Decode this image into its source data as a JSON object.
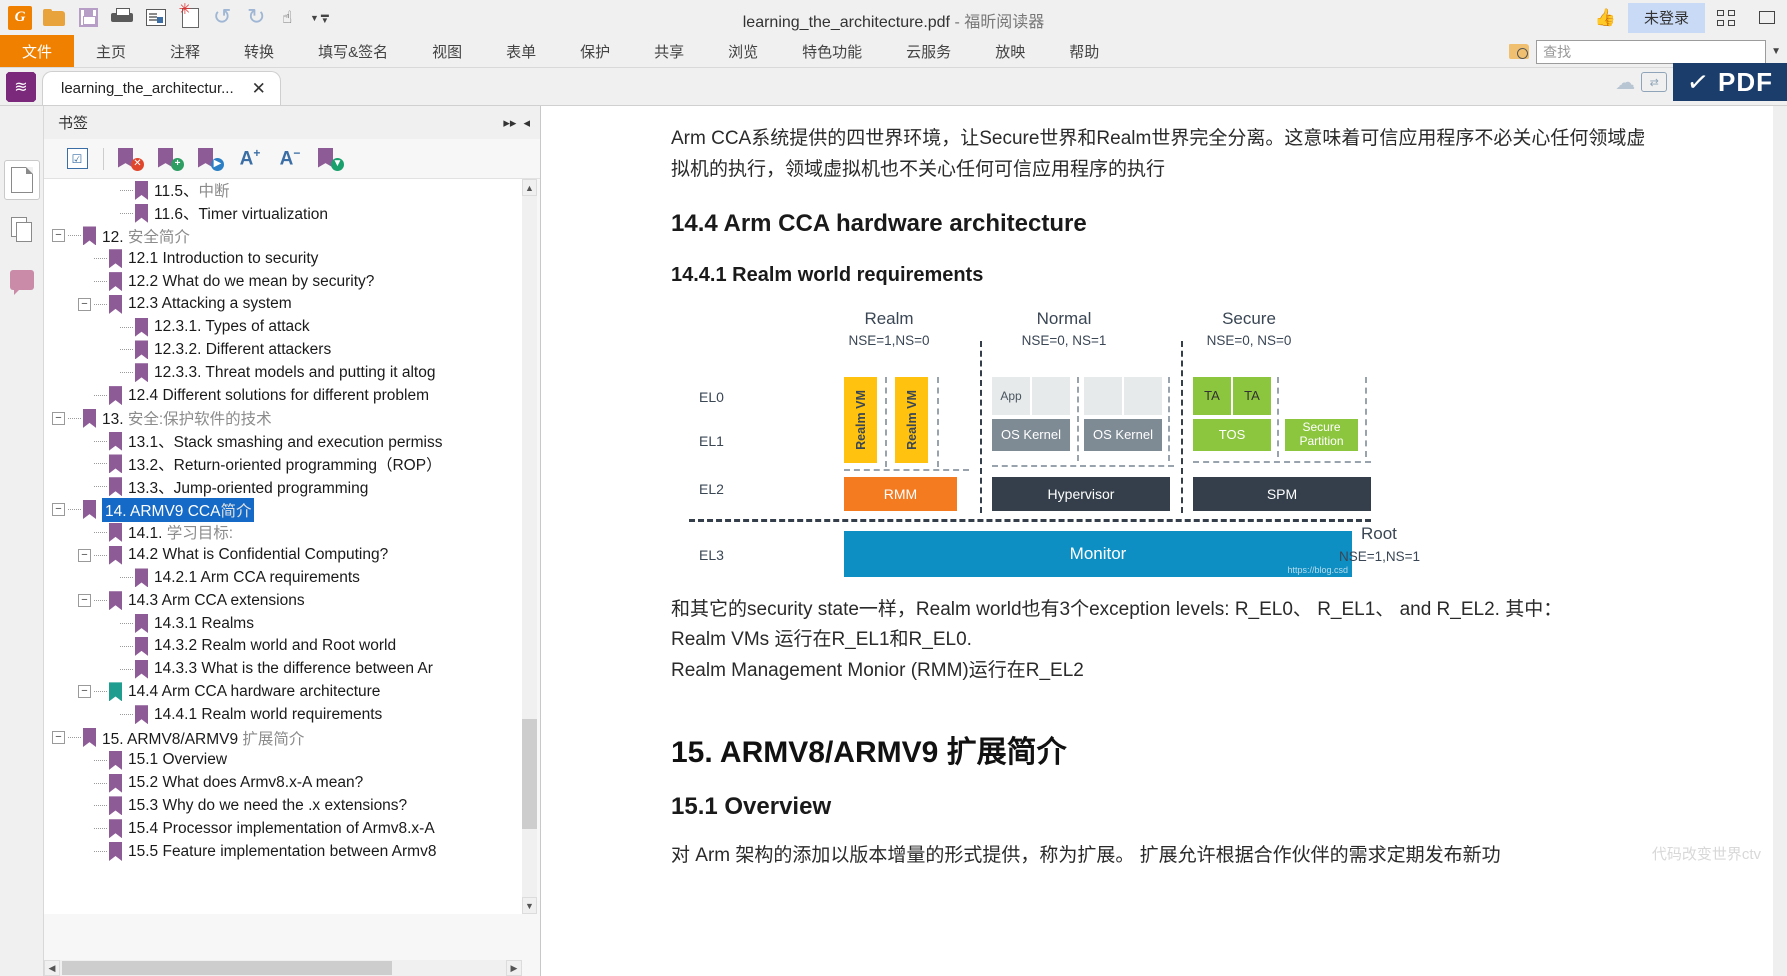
{
  "window": {
    "title_file": "learning_the_architecture.pdf",
    "title_sep": " - ",
    "title_app": "福昕阅读器",
    "login_status": "未登录"
  },
  "quick_access": [
    {
      "name": "app-logo-icon",
      "label": "G"
    },
    {
      "name": "open-folder-icon",
      "label": ""
    },
    {
      "name": "save-icon",
      "label": ""
    },
    {
      "name": "print-icon",
      "label": ""
    },
    {
      "name": "properties-icon",
      "label": ""
    },
    {
      "name": "new-document-icon",
      "label": ""
    },
    {
      "name": "undo-icon",
      "label": "↶"
    },
    {
      "name": "redo-icon",
      "label": "↷"
    },
    {
      "name": "hand-tool-icon",
      "label": "☝"
    }
  ],
  "menu": {
    "items": [
      {
        "label": "文件",
        "active": true
      },
      {
        "label": "主页",
        "active": false
      },
      {
        "label": "注释",
        "active": false
      },
      {
        "label": "转换",
        "active": false
      },
      {
        "label": "填写&签名",
        "active": false
      },
      {
        "label": "视图",
        "active": false
      },
      {
        "label": "表单",
        "active": false
      },
      {
        "label": "保护",
        "active": false
      },
      {
        "label": "共享",
        "active": false
      },
      {
        "label": "浏览",
        "active": false
      },
      {
        "label": "特色功能",
        "active": false
      },
      {
        "label": "云服务",
        "active": false
      },
      {
        "label": "放映",
        "active": false
      },
      {
        "label": "帮助",
        "active": false
      }
    ]
  },
  "find": {
    "placeholder": "查找",
    "value": ""
  },
  "tab": {
    "label": "learning_the_architectur...",
    "close": "✕"
  },
  "pdf_banner": {
    "label": "PDF"
  },
  "bookmark_panel": {
    "title": "书签",
    "collapse_icon": "▸▸",
    "pin_icon": "◂",
    "toolbar": [
      {
        "name": "checklist-icon",
        "label": "☑"
      },
      {
        "name": "delete-bookmark-icon",
        "label": "✕"
      },
      {
        "name": "add-bookmark-icon",
        "label": "+"
      },
      {
        "name": "goto-bookmark-icon",
        "label": "▶"
      },
      {
        "name": "increase-font-icon",
        "label": "A",
        "sup": "+"
      },
      {
        "name": "decrease-font-icon",
        "label": "A",
        "sup": "−"
      },
      {
        "name": "expand-bookmark-icon",
        "label": "▾"
      }
    ],
    "items": [
      {
        "depth": 2,
        "toggle": null,
        "label": "11.5、",
        "cn": "中断",
        "mark": "purple",
        "selected": false
      },
      {
        "depth": 2,
        "toggle": null,
        "label": "11.6、Timer virtualization",
        "cn": "",
        "mark": "purple",
        "selected": false
      },
      {
        "depth": 0,
        "toggle": "−",
        "label": "12. ",
        "cn": "安全简介",
        "mark": "purple",
        "selected": false
      },
      {
        "depth": 1,
        "toggle": null,
        "label": "12.1 Introduction to security",
        "cn": "",
        "mark": "purple",
        "selected": false
      },
      {
        "depth": 1,
        "toggle": null,
        "label": "12.2 What do we mean by security?",
        "cn": "",
        "mark": "purple",
        "selected": false
      },
      {
        "depth": 1,
        "toggle": "−",
        "label": "12.3 Attacking a system",
        "cn": "",
        "mark": "purple",
        "selected": false
      },
      {
        "depth": 2,
        "toggle": null,
        "label": "12.3.1. Types of attack",
        "cn": "",
        "mark": "purple",
        "selected": false
      },
      {
        "depth": 2,
        "toggle": null,
        "label": "12.3.2. Different attackers",
        "cn": "",
        "mark": "purple",
        "selected": false
      },
      {
        "depth": 2,
        "toggle": null,
        "label": "12.3.3. Threat models and putting it altog",
        "cn": "",
        "mark": "purple",
        "selected": false
      },
      {
        "depth": 1,
        "toggle": null,
        "label": "12.4 Different solutions for different problem",
        "cn": "",
        "mark": "purple",
        "selected": false
      },
      {
        "depth": 0,
        "toggle": "−",
        "label": "13. ",
        "cn": "安全:保护软件的技术",
        "mark": "purple",
        "selected": false
      },
      {
        "depth": 1,
        "toggle": null,
        "label": "13.1、Stack smashing and execution permiss",
        "cn": "",
        "mark": "purple",
        "selected": false
      },
      {
        "depth": 1,
        "toggle": null,
        "label": "13.2、Return-oriented programming（ROP）",
        "cn": "",
        "mark": "purple",
        "selected": false
      },
      {
        "depth": 1,
        "toggle": null,
        "label": "13.3、Jump-oriented programming",
        "cn": "",
        "mark": "purple",
        "selected": false
      },
      {
        "depth": 0,
        "toggle": "−",
        "label": "14. ARMV9 CCA",
        "cn": "简介",
        "mark": "purple",
        "selected": true
      },
      {
        "depth": 1,
        "toggle": null,
        "label": "14.1. ",
        "cn": "学习目标:",
        "mark": "purple",
        "selected": false
      },
      {
        "depth": 1,
        "toggle": "−",
        "label": "14.2 What is Confidential Computing?",
        "cn": "",
        "mark": "purple",
        "selected": false
      },
      {
        "depth": 2,
        "toggle": null,
        "label": "14.2.1 Arm CCA requirements",
        "cn": "",
        "mark": "purple",
        "selected": false
      },
      {
        "depth": 1,
        "toggle": "−",
        "label": "14.3 Arm CCA extensions",
        "cn": "",
        "mark": "purple",
        "selected": false
      },
      {
        "depth": 2,
        "toggle": null,
        "label": "14.3.1 Realms",
        "cn": "",
        "mark": "purple",
        "selected": false
      },
      {
        "depth": 2,
        "toggle": null,
        "label": "14.3.2 Realm world and Root world",
        "cn": "",
        "mark": "purple",
        "selected": false
      },
      {
        "depth": 2,
        "toggle": null,
        "label": "14.3.3 What is the difference between Ar",
        "cn": "",
        "mark": "purple",
        "selected": false
      },
      {
        "depth": 1,
        "toggle": "−",
        "label": "14.4 Arm CCA hardware architecture",
        "cn": "",
        "mark": "teal",
        "selected": false
      },
      {
        "depth": 2,
        "toggle": null,
        "label": "14.4.1 Realm world requirements",
        "cn": "",
        "mark": "purple",
        "selected": false
      },
      {
        "depth": 0,
        "toggle": "−",
        "label": "15. ARMV8/ARMV9 ",
        "cn": "扩展简介",
        "mark": "purple",
        "selected": false
      },
      {
        "depth": 1,
        "toggle": null,
        "label": "15.1 Overview",
        "cn": "",
        "mark": "purple",
        "selected": false
      },
      {
        "depth": 1,
        "toggle": null,
        "label": "15.2 What does Armv8.x-A mean?",
        "cn": "",
        "mark": "purple",
        "selected": false
      },
      {
        "depth": 1,
        "toggle": null,
        "label": "15.3 Why do we need the .x extensions?",
        "cn": "",
        "mark": "purple",
        "selected": false
      },
      {
        "depth": 1,
        "toggle": null,
        "label": "15.4 Processor implementation of Armv8.x-A",
        "cn": "",
        "mark": "purple",
        "selected": false
      },
      {
        "depth": 1,
        "toggle": null,
        "label": "15.5 Feature implementation between Armv8",
        "cn": "",
        "mark": "purple",
        "selected": false
      }
    ]
  },
  "document": {
    "intro_paragraph": "Arm CCA系统提供的四世界环境，让Secure世界和Realm世界完全分离。这意味着可信应用程序不必关心任何领域虚拟机的执行，领域虚拟机也不关心任何可信应用程序的执行",
    "heading_14_4": "14.4 Arm CCA hardware architecture",
    "heading_14_4_1": "14.4.1 Realm world requirements",
    "after_diagram_line1": "和其它的security state一样，Realm world也有3个exception levels: R_EL0、 R_EL1、 and R_EL2. 其中：",
    "after_diagram_line2": "Realm VMs 运行在R_EL1和R_EL0.",
    "after_diagram_line3": "Realm Management Monior (RMM)运行在R_EL2",
    "heading_15": "15. ARMV8/ARMV9 扩展简介",
    "heading_15_1": "15.1 Overview",
    "paragraph_15_1": "对 Arm 架构的添加以版本增量的形式提供，称为扩展。 扩展允许根据合作伙伴的需求定期发布新功",
    "watermark_right": "代码改变世界ctv",
    "diagram_watermark": "https://blog.csd"
  },
  "diagram": {
    "exception_levels": [
      "EL0",
      "EL1",
      "EL2",
      "EL3"
    ],
    "worlds": [
      {
        "name": "Realm",
        "flags": "NSE=1,NS=0"
      },
      {
        "name": "Normal",
        "flags": "NSE=0, NS=1"
      },
      {
        "name": "Secure",
        "flags": "NSE=0, NS=0"
      }
    ],
    "root": {
      "name": "Root",
      "flags": "NSE=1,NS=1"
    },
    "realm_vms": [
      "Realm VM",
      "Realm VM"
    ],
    "realm_el2": "RMM",
    "normal_el0": [
      "App",
      "",
      "",
      ""
    ],
    "normal_el1": [
      "OS Kernel",
      "OS Kernel"
    ],
    "normal_el2": "Hypervisor",
    "secure_el0": [
      "TA",
      "TA"
    ],
    "secure_el1": [
      "TOS",
      "Secure Partition"
    ],
    "secure_el2": "SPM",
    "el3": "Monitor",
    "colors": {
      "realm_vm": "#ffc20e",
      "rmm": "#f47b20",
      "kernel": "#7e8a94",
      "app": "#e6eaea",
      "dark": "#343f4b",
      "green": "#8cc63e",
      "monitor": "#0d8fc4"
    }
  }
}
